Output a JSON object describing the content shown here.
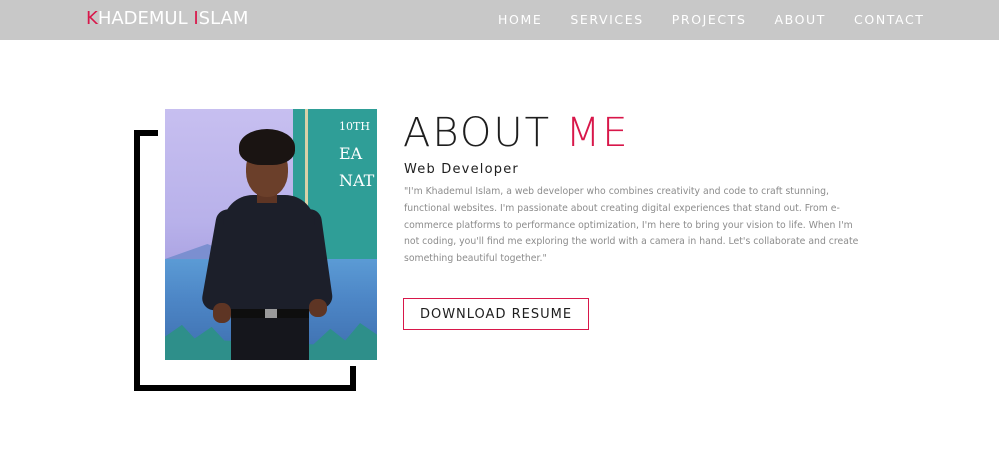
{
  "header": {
    "logo": {
      "first_initial": "K",
      "first_rest": "HADEMUL ",
      "last_initial": "I",
      "last_rest": "SLAM"
    },
    "nav": [
      "HOME",
      "SERVICES",
      "PROJECTS",
      "ABOUT",
      "CONTACT"
    ]
  },
  "photo": {
    "sign_text": [
      "10TH",
      "EA",
      "NAT"
    ]
  },
  "about": {
    "title_main": "ABOUT ",
    "title_accent": "ME",
    "role": "Web Developer",
    "bio": "\"I'm Khademul Islam, a web developer who combines creativity and code to craft stunning, functional websites. I'm passionate about creating digital experiences that stand out. From e-commerce platforms to performance optimization, I'm here to bring your vision to life. When I'm not coding, you'll find me exploring the world with a camera in hand. Let's collaborate and create something beautiful together.\"",
    "button_label": "DOWNLOAD RESUME"
  },
  "colors": {
    "accent": "#d8174a",
    "navbar": "#c8c8c8",
    "text": "#1e1e1e",
    "muted": "#8c8c8c"
  }
}
